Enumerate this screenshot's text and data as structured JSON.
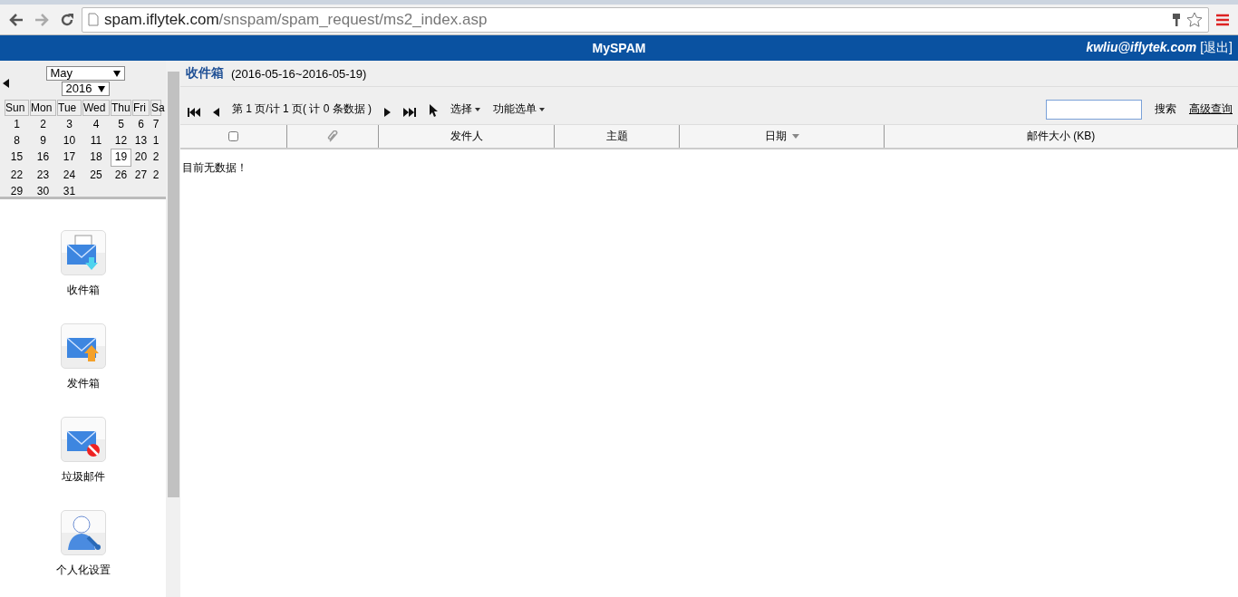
{
  "browser": {
    "url_host": "spam.iflytek.com",
    "url_path": "/snspam/spam_request/ms2_index.asp",
    "forward_disabled": true
  },
  "header": {
    "title": "MySPAM",
    "user": "kwliu@iflytek.com",
    "logout": "[退出]"
  },
  "calendar": {
    "month": "May",
    "year": "2016",
    "weekdays": [
      "Sun",
      "Mon",
      "Tue",
      "Wed",
      "Thu",
      "Fri",
      "Sa"
    ],
    "weeks": [
      [
        {
          "day": "1",
          "selected": false
        },
        {
          "day": "2",
          "selected": false
        },
        {
          "day": "3",
          "selected": false
        },
        {
          "day": "4",
          "selected": false
        },
        {
          "day": "5",
          "selected": false
        },
        {
          "day": "6",
          "selected": false
        },
        {
          "day": "7",
          "selected": false
        }
      ],
      [
        {
          "day": "8",
          "selected": false
        },
        {
          "day": "9",
          "selected": false
        },
        {
          "day": "10",
          "selected": false
        },
        {
          "day": "11",
          "selected": false
        },
        {
          "day": "12",
          "selected": false
        },
        {
          "day": "13",
          "selected": false
        },
        {
          "day": "1",
          "selected": false
        }
      ],
      [
        {
          "day": "15",
          "selected": false
        },
        {
          "day": "16",
          "selected": false
        },
        {
          "day": "17",
          "selected": false
        },
        {
          "day": "18",
          "selected": false
        },
        {
          "day": "19",
          "selected": true
        },
        {
          "day": "20",
          "selected": false
        },
        {
          "day": "2",
          "selected": false
        }
      ],
      [
        {
          "day": "22",
          "selected": false
        },
        {
          "day": "23",
          "selected": false
        },
        {
          "day": "24",
          "selected": false
        },
        {
          "day": "25",
          "selected": false
        },
        {
          "day": "26",
          "selected": false
        },
        {
          "day": "27",
          "selected": false
        },
        {
          "day": "2",
          "selected": false
        }
      ],
      [
        {
          "day": "29",
          "selected": false
        },
        {
          "day": "30",
          "selected": false
        },
        {
          "day": "31",
          "selected": false
        }
      ]
    ]
  },
  "sidebar": {
    "items": [
      {
        "kind": "inbox",
        "label": "收件箱"
      },
      {
        "kind": "outbox",
        "label": "发件箱"
      },
      {
        "kind": "spam",
        "label": "垃圾邮件"
      },
      {
        "kind": "settings",
        "label": "个人化设置"
      }
    ]
  },
  "main": {
    "title": "收件箱",
    "range": "(2016-05-16~2016-05-19)",
    "pager": "第 1 页/计 1 页( 计 0 条数据 )",
    "menus": [
      "选择",
      "功能选单"
    ],
    "search_button": "搜索",
    "advanced_link": "高级查询",
    "table": {
      "select_all_checked": false,
      "columns": [
        {
          "label": "发件人",
          "sorted": false
        },
        {
          "label": "主题",
          "sorted": false
        },
        {
          "label": "日期",
          "sorted": true
        },
        {
          "label": "邮件大小 (KB)",
          "sorted": false
        }
      ],
      "empty": "目前无数据！"
    }
  }
}
